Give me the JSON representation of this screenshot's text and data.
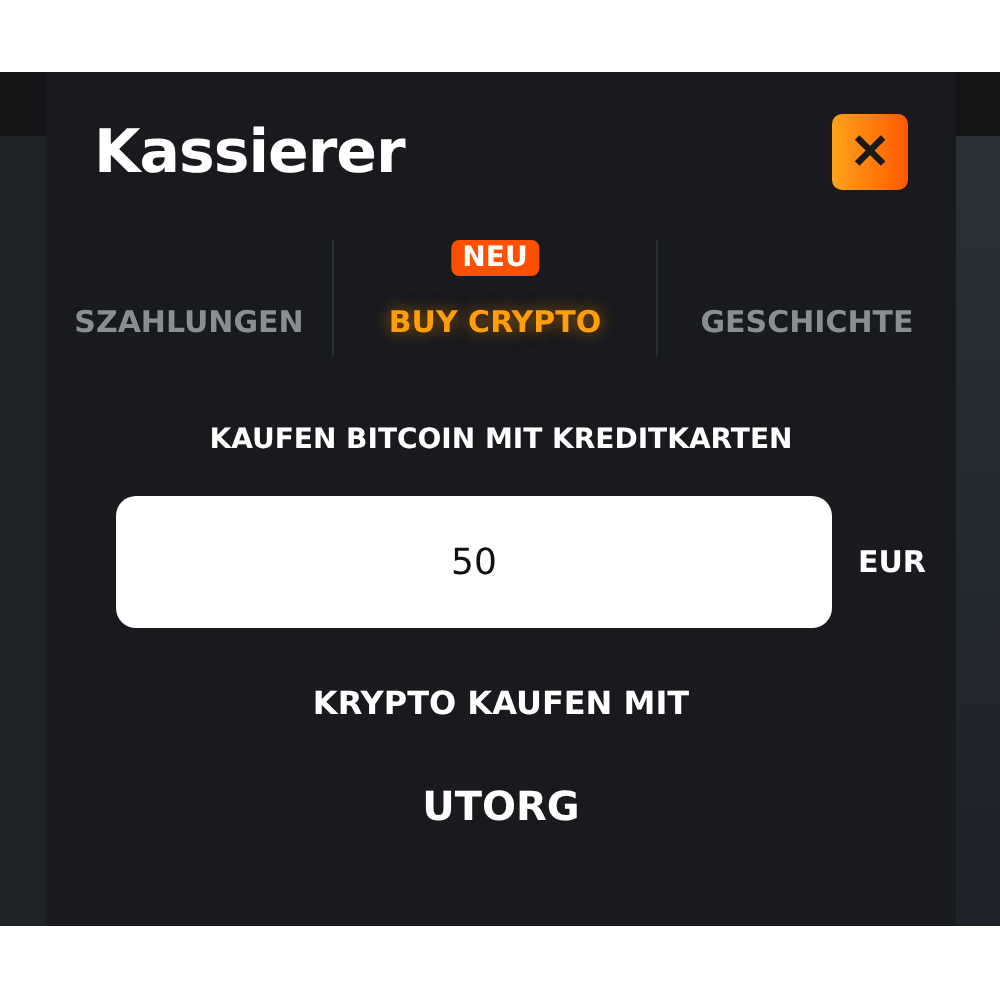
{
  "dialog": {
    "title": "Kassierer",
    "close_label": "✕"
  },
  "tabs": [
    {
      "label": "SZAHLUNGEN",
      "selected": false
    },
    {
      "label": "BUY CRYPTO",
      "selected": true,
      "badge": "NEU"
    },
    {
      "label": "GESCHICHTE",
      "selected": false
    }
  ],
  "heading": "KAUFEN BITCOIN MIT KREDITKARTEN",
  "amount": {
    "value": "50",
    "currency": "EUR"
  },
  "method_heading": "KRYPTO KAUFEN MIT",
  "provider": "UTORG"
}
